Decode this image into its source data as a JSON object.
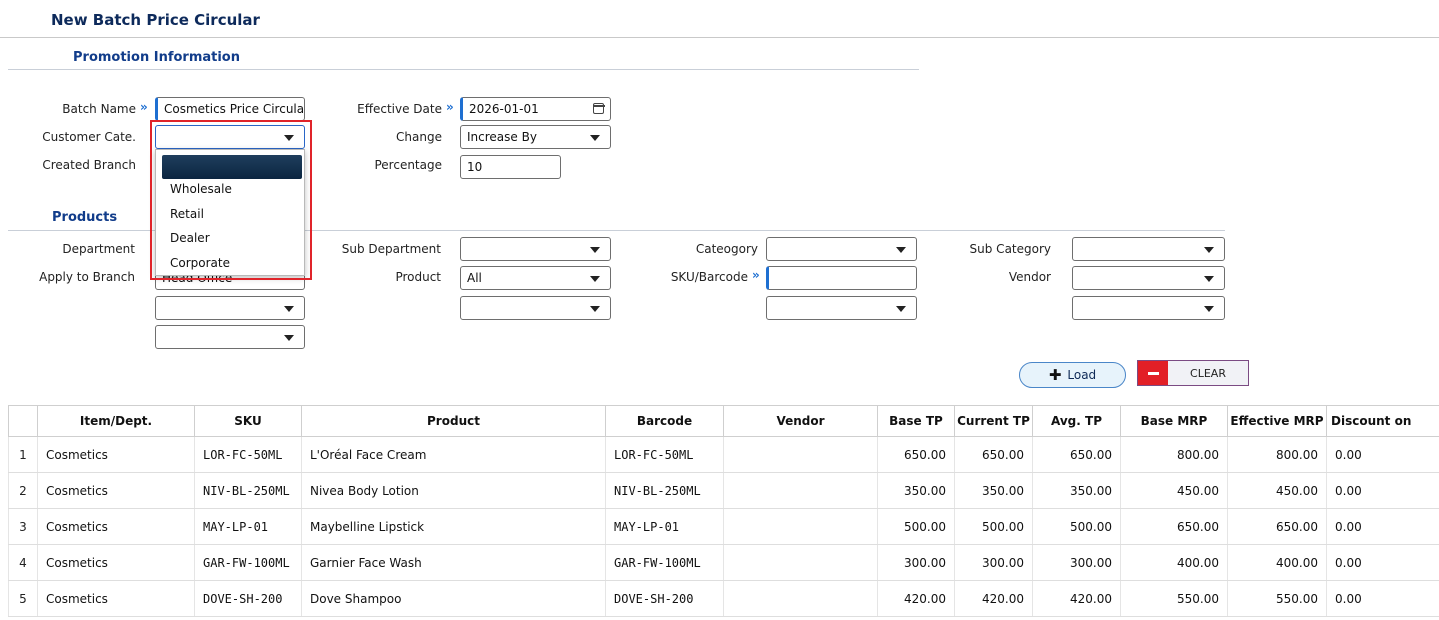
{
  "page_title": "New Batch Price Circular",
  "promotion_section": {
    "title": "Promotion Information",
    "batch_name_label": "Batch Name",
    "batch_name_value": "Cosmetics Price Circular",
    "customer_cate_label": "Customer Cate.",
    "customer_cate_value": "",
    "created_branch_label": "Created Branch",
    "effective_date_label": "Effective Date",
    "effective_date_value": "2026-01-01",
    "change_label": "Change",
    "change_value": "Increase By",
    "percentage_label": "Percentage",
    "percentage_value": "10"
  },
  "customer_dropdown": {
    "options": [
      "Wholesale",
      "Retail",
      "Dealer",
      "Corporate"
    ]
  },
  "products_section": {
    "title": "Products",
    "department_label": "Department",
    "apply_branch_label": "Apply to Branch",
    "apply_branch_value": "Head Office",
    "sub_department_label": "Sub Department",
    "product_label": "Product",
    "product_value": "All",
    "category_label": "Cateogory",
    "sku_label": "SKU/Barcode",
    "sub_category_label": "Sub Category",
    "vendor_label": "Vendor"
  },
  "buttons": {
    "load": "Load",
    "clear": "CLEAR"
  },
  "table": {
    "columns": [
      "",
      "Item/Dept.",
      "SKU",
      "Product",
      "Barcode",
      "Vendor",
      "Base TP",
      "Current TP",
      "Avg. TP",
      "Base MRP",
      "Effective MRP",
      "Discount on"
    ],
    "rows": [
      [
        "1",
        "Cosmetics",
        "LOR-FC-50ML",
        "L'Oréal Face Cream",
        "LOR-FC-50ML",
        "",
        "650.00",
        "650.00",
        "650.00",
        "800.00",
        "800.00",
        "0.00"
      ],
      [
        "2",
        "Cosmetics",
        "NIV-BL-250ML",
        "Nivea Body Lotion",
        "NIV-BL-250ML",
        "",
        "350.00",
        "350.00",
        "350.00",
        "450.00",
        "450.00",
        "0.00"
      ],
      [
        "3",
        "Cosmetics",
        "MAY-LP-01",
        "Maybelline Lipstick",
        "MAY-LP-01",
        "",
        "500.00",
        "500.00",
        "500.00",
        "650.00",
        "650.00",
        "0.00"
      ],
      [
        "4",
        "Cosmetics",
        "GAR-FW-100ML",
        "Garnier Face Wash",
        "GAR-FW-100ML",
        "",
        "300.00",
        "300.00",
        "300.00",
        "400.00",
        "400.00",
        "0.00"
      ],
      [
        "5",
        "Cosmetics",
        "DOVE-SH-200",
        "Dove Shampoo",
        "DOVE-SH-200",
        "",
        "420.00",
        "420.00",
        "420.00",
        "550.00",
        "550.00",
        "0.00"
      ]
    ]
  },
  "colors": {
    "accent": "#1e6fd1",
    "title": "#0d2a5b",
    "highlight_box": "#e0242a",
    "clear_minus": "#e21f26"
  }
}
